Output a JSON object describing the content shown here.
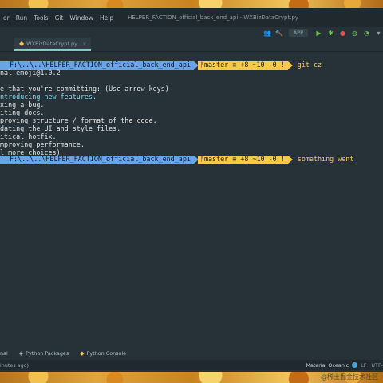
{
  "menu": [
    "or",
    "Run",
    "Tools",
    "Git",
    "Window",
    "Help"
  ],
  "window_title": "HELPER_FACTION_official_back_end_api - WXBizDataCrypt.py",
  "toolbar": {
    "run_config": "APP"
  },
  "tab": {
    "label": "WXBizDataCrypt.py"
  },
  "terminal": {
    "prompt_path": "F:\\..\\..\\HELPER_FACTION_official_back_end_api",
    "prompt_git": "master ≡ +8 ~10 -0 !",
    "command": "git cz",
    "lines": [
      "nal-emoji@1.0.2",
      "",
      "e that you're committing: (Use arrow keys)",
      "ntroducing new features.",
      "xing a bug.",
      "iting docs.",
      "proving structure / format of the code.",
      "dating the UI and style files.",
      "itical hotfix.",
      "mproving performance.",
      "l more choices)"
    ],
    "second_command": "something went"
  },
  "bottom_tabs": [
    "nal",
    "Python Packages",
    "Python Console"
  ],
  "status": {
    "left": "inutes ago)",
    "theme": "Material Oceanic",
    "encoding": "LF",
    "charset": "UTF-"
  },
  "watermark": "@稀土掘金技术社区"
}
